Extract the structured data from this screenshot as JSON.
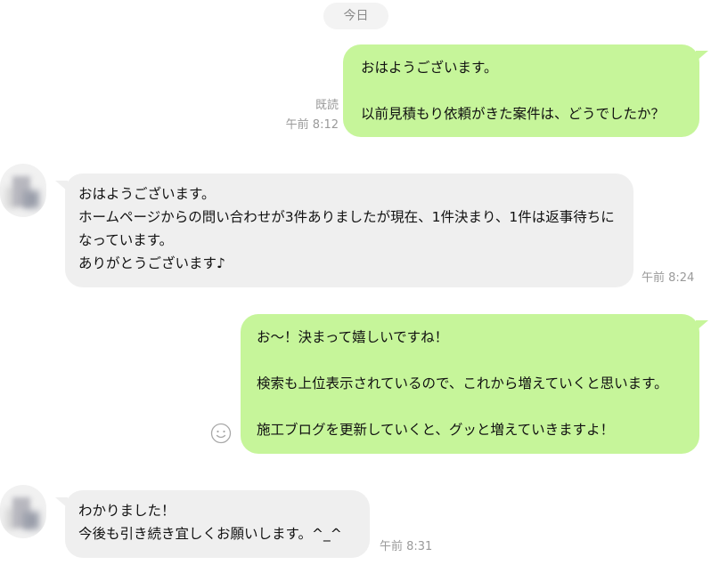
{
  "date_divider": "今日",
  "messages": [
    {
      "direction": "sent",
      "text": "おはようございます。\n\n以前見積もり依頼がきた案件は、どうでしたか？",
      "read_label": "既読",
      "time": "午前 8:12"
    },
    {
      "direction": "received",
      "text": "おはようございます。\nホームページからの問い合わせが3件ありましたが現在、1件決まり、1件は返事待ちになっています。\nありがとうございます♪",
      "time": "午前 8:24"
    },
    {
      "direction": "sent",
      "text": "お～！決まって嬉しいですね！\n\n検索も上位表示されているので、これから増えていくと思います。\n\n施工ブログを更新していくと、グッと増えていきますよ！",
      "time": ""
    },
    {
      "direction": "received",
      "text": "わかりました！\n今後も引き続き宜しくお願いします。^_^",
      "time": "午前 8:31"
    }
  ],
  "colors": {
    "sent_bubble": "#c6f59a",
    "received_bubble": "#efefef",
    "meta_text": "#9a9a9a"
  },
  "icons": {
    "reaction": "smiley-face-icon"
  }
}
